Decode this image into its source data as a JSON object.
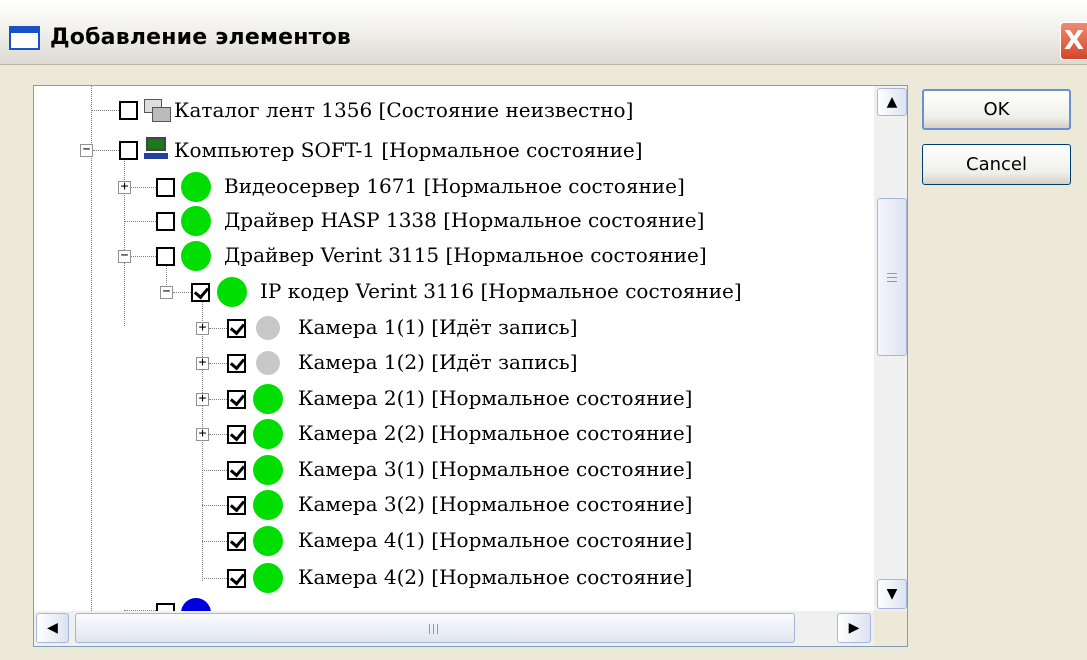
{
  "window": {
    "title": "Добавление элементов",
    "icon": "window-icon",
    "close_label": "X"
  },
  "tree": {
    "items": [
      {
        "label": "Каталог лент 1356 [Состояние неизвестно]",
        "checked": false,
        "icon": "tape-catalog-icon"
      },
      {
        "label": "Компьютер SOFT-1 [Нормальное состояние]",
        "checked": false,
        "icon": "computer-icon",
        "expanded": true
      },
      {
        "label": "Видеосервер 1671 [Нормальное состояние]",
        "checked": false,
        "icon": "status-green-icon",
        "expandable": true
      },
      {
        "label": "Драйвер HASP 1338 [Нормальное состояние]",
        "checked": false,
        "icon": "status-green-icon"
      },
      {
        "label": "Драйвер Verint 3115 [Нормальное состояние]",
        "checked": false,
        "icon": "status-green-icon",
        "expanded": true
      },
      {
        "label": "IP кодер Verint 3116 [Нормальное состояние]",
        "checked": true,
        "icon": "status-green-icon",
        "expanded": true
      },
      {
        "label": "Камера 1(1) [Идёт запись]",
        "checked": true,
        "icon": "status-gray-icon",
        "expandable": true
      },
      {
        "label": "Камера 1(2) [Идёт запись]",
        "checked": true,
        "icon": "status-gray-icon",
        "expandable": true
      },
      {
        "label": "Камера 2(1) [Нормальное состояние]",
        "checked": true,
        "icon": "status-green-icon",
        "expandable": true
      },
      {
        "label": "Камера 2(2) [Нормальное состояние]",
        "checked": true,
        "icon": "status-green-icon",
        "expandable": true
      },
      {
        "label": "Камера 3(1) [Нормальное состояние]",
        "checked": true,
        "icon": "status-green-icon"
      },
      {
        "label": "Камера 3(2) [Нормальное состояние]",
        "checked": true,
        "icon": "status-green-icon"
      },
      {
        "label": "Камера 4(1) [Нормальное состояние]",
        "checked": true,
        "icon": "status-green-icon"
      },
      {
        "label": "Камера 4(2) [Нормальное состояние]",
        "checked": true,
        "icon": "status-green-icon"
      }
    ]
  },
  "buttons": {
    "ok": "OK",
    "cancel": "Cancel"
  },
  "colors": {
    "status_green": "#00dd00",
    "status_gray": "#c8c8c8",
    "status_blue": "#0000dd"
  }
}
